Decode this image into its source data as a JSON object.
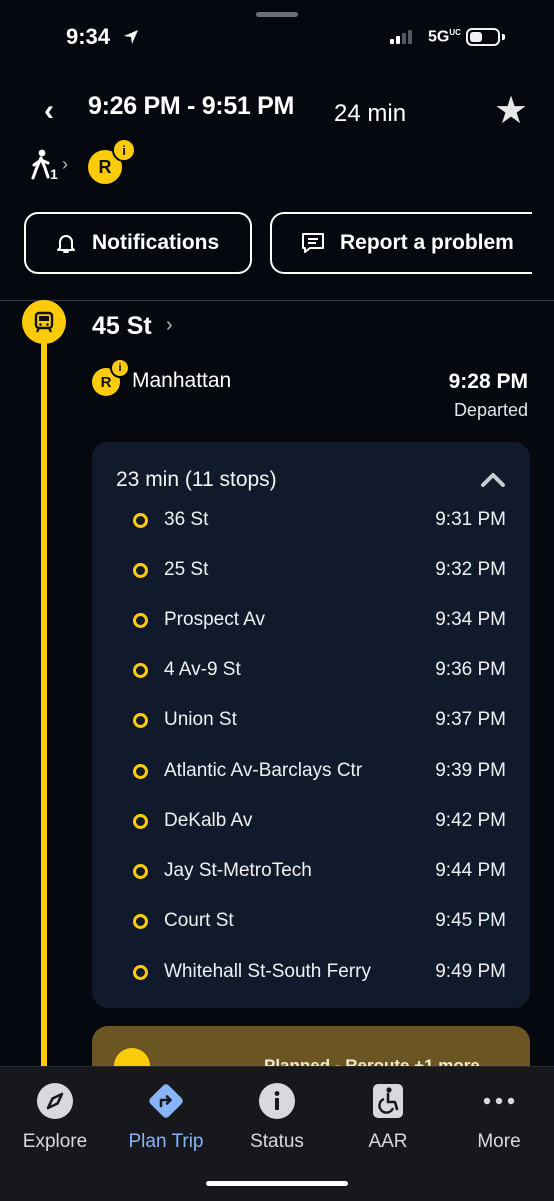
{
  "status_bar": {
    "time": "9:34",
    "network": "5G",
    "network_sup": "UC"
  },
  "header": {
    "time_range": "9:26 PM - 9:51 PM",
    "duration": "24 min",
    "walk_subscript": "1",
    "route": "R",
    "route_info_badge": "i"
  },
  "actions": {
    "notifications": "Notifications",
    "report": "Report a problem"
  },
  "leg": {
    "station": "45 St",
    "route": "R",
    "direction": "Manhattan",
    "time": "9:28 PM",
    "status": "Departed",
    "summary": "23 min (11 stops)",
    "stops": [
      {
        "name": "36 St",
        "time": "9:31 PM"
      },
      {
        "name": "25 St",
        "time": "9:32 PM"
      },
      {
        "name": "Prospect Av",
        "time": "9:34 PM"
      },
      {
        "name": "4 Av-9 St",
        "time": "9:36 PM"
      },
      {
        "name": "Union St",
        "time": "9:37 PM"
      },
      {
        "name": "Atlantic Av-Barclays Ctr",
        "time": "9:39 PM"
      },
      {
        "name": "DeKalb Av",
        "time": "9:42 PM"
      },
      {
        "name": "Jay St-MetroTech",
        "time": "9:44 PM"
      },
      {
        "name": "Court St",
        "time": "9:45 PM"
      },
      {
        "name": "Whitehall St-South Ferry",
        "time": "9:49 PM"
      }
    ]
  },
  "alert": {
    "text": "Planned - Reroute +1 more"
  },
  "tabbar": {
    "items": [
      {
        "label": "Explore"
      },
      {
        "label": "Plan Trip"
      },
      {
        "label": "Status"
      },
      {
        "label": "AAR"
      },
      {
        "label": "More"
      }
    ],
    "active": "Plan Trip"
  },
  "colors": {
    "accent": "#fccc0a",
    "active_tab": "#8ab4f8",
    "background": "#05080f",
    "card": "#111a2b"
  }
}
